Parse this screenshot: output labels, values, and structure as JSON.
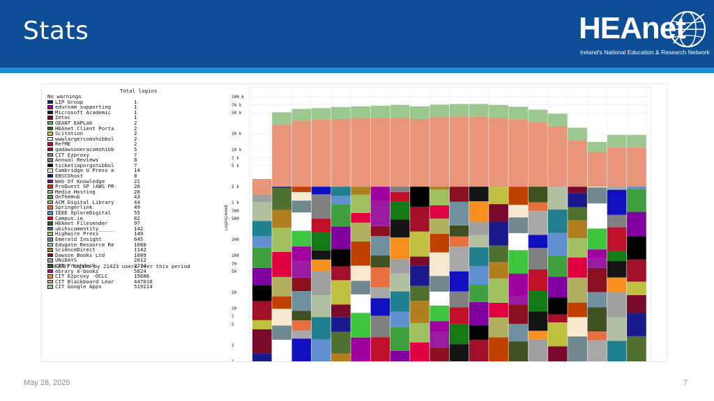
{
  "slide": {
    "title": "Stats",
    "date": "May 28, 2025",
    "page_number": "7"
  },
  "logo": {
    "name": "HEAnet",
    "tagline": "Ireland's National Education & Research Network"
  },
  "colors": {
    "header_bg": "#0d4e96",
    "header_stripe": "#1e8fd6"
  },
  "legend": {
    "title": "Total logins",
    "summary": "1003987 logins by 21423 users over this period",
    "entries": [
      {
        "name": "No warnings",
        "value": "",
        "color": ""
      },
      {
        "name": "LIP Group",
        "value": "1",
        "color": "#1a1a8c"
      },
      {
        "name": "eduroam supporting",
        "value": "1",
        "color": "#a000a0"
      },
      {
        "name": "Microsoft Academic",
        "value": "1",
        "color": "#151515"
      },
      {
        "name": "Zetoc",
        "value": "1",
        "color": "#7a0a2c"
      },
      {
        "name": "GEANT EAPLab",
        "value": "2",
        "color": "#3ec43e"
      },
      {
        "name": "HEAnet Client Porta",
        "value": "2",
        "color": "#157a15"
      },
      {
        "name": "Scitation",
        "value": "2",
        "color": "#c0c040"
      },
      {
        "name": "wwwlargercomshibbol",
        "value": "2",
        "color": "#ffffff"
      },
      {
        "name": "RefME",
        "value": "2",
        "color": "#c0102c"
      },
      {
        "name": "qadawsoneracomshibb",
        "value": "5",
        "color": "#a01028"
      },
      {
        "name": "CIT Ezproxy",
        "value": "7",
        "color": "#708890"
      },
      {
        "name": "Annual Reviews",
        "value": "8",
        "color": "#808080"
      },
      {
        "name": "ticketioporgshibbol",
        "value": "7",
        "color": "#000000"
      },
      {
        "name": "Cambridge U Press e",
        "value": "14",
        "color": "#f8e8d0"
      },
      {
        "name": "EBSCOhost",
        "value": "8",
        "color": "#1010c0"
      },
      {
        "name": "Web Of Knowledge",
        "value": "21",
        "color": "#8000a0"
      },
      {
        "name": "ProQuest SP (AWS PR",
        "value": "26",
        "color": "#c04000"
      },
      {
        "name": "Media Hosting",
        "value": "28",
        "color": "#a8a8a8"
      },
      {
        "name": "OnTheHub",
        "value": "43",
        "color": "#40a040"
      },
      {
        "name": "ACM Digital Library",
        "value": "44",
        "color": "#b0b060"
      },
      {
        "name": "Springerlink",
        "value": "49",
        "color": "#e87040"
      },
      {
        "name": "IEEE XploreDigital",
        "value": "55",
        "color": "#6090d0"
      },
      {
        "name": "Campus.ie",
        "value": "82",
        "color": "#e00040"
      },
      {
        "name": "HEAnet Filesender",
        "value": "97",
        "color": "#405020"
      },
      {
        "name": "ukihscomentity_____",
        "value": "142",
        "color": "#208090"
      },
      {
        "name": "Highwire Press",
        "value": "149",
        "color": "#a0c060"
      },
      {
        "name": "Emerald Insight",
        "value": "645",
        "color": "#7090a0"
      },
      {
        "name": "Edugate Resource Re",
        "value": "1088",
        "color": "#b0c0a0"
      },
      {
        "name": "ScienceDirect",
        "value": "1142",
        "color": "#b08020"
      },
      {
        "name": "Dawson Books Ltd",
        "value": "1689",
        "color": "#8a1020"
      },
      {
        "name": "UNiDAYS",
        "value": "2012",
        "color": "#a0a0a0"
      },
      {
        "name": "CIT Freshdesk",
        "value": "2274",
        "color": "#507030"
      },
      {
        "name": "ebrary e-books",
        "value": "5824",
        "color": "#9a1aa0"
      },
      {
        "name": "CIT Ezproxy -OCLC",
        "value": "15686",
        "color": "#f89020"
      },
      {
        "name": "CIT Blackboard Lear",
        "value": "447016",
        "color": "#e8957a"
      },
      {
        "name": "CIT Google Apps",
        "value": "519214",
        "color": "#9cc890"
      }
    ]
  },
  "chart_data": {
    "type": "bar",
    "stacked": true,
    "ylabel": "Logins/week",
    "yscale": "log",
    "y_ticks": [
      "100 k",
      "70 k",
      "50 k",
      "20 k",
      "10 k",
      "7 k",
      "5 k",
      "2 k",
      "1 k",
      "700",
      "500",
      "200",
      "100",
      "70",
      "50",
      "20",
      "10",
      "7",
      "5",
      "2",
      "1"
    ],
    "grid": true,
    "bars_visible": 20,
    "google_apps_top": [
      2800,
      51000,
      59000,
      61000,
      64000,
      66000,
      68000,
      70000,
      66000,
      71000,
      73000,
      73000,
      70000,
      65000,
      57000,
      48000,
      26000,
      14000,
      19000,
      19000
    ],
    "blackboard_top": [
      2800,
      30000,
      35000,
      37000,
      38000,
      39000,
      40000,
      40000,
      38000,
      41000,
      42000,
      42000,
      40000,
      37000,
      33000,
      28000,
      15000,
      9000,
      11000,
      11000
    ]
  }
}
